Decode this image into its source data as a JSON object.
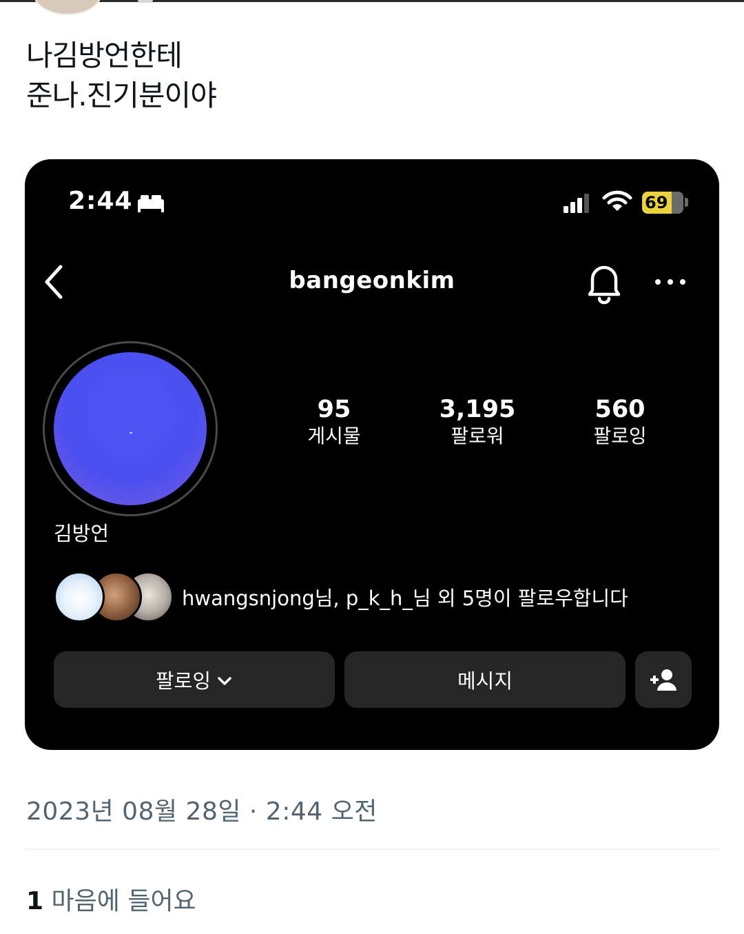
{
  "tweet": {
    "line1": "나김방언한테",
    "line2": "준나.진기분이야",
    "timestamp": "2023년 08월 28일 · 2:44 오전",
    "likes_count": "1",
    "likes_label": "마음에 들어요"
  },
  "phone": {
    "status": {
      "time": "2:44",
      "battery": "69",
      "battery_color": "#e9d23a",
      "icons": [
        "bed-icon",
        "signal-icon",
        "wifi-icon",
        "battery-icon"
      ]
    },
    "header": {
      "username": "bangeonkim",
      "icons": [
        "back-chevron-icon",
        "bell-icon",
        "more-icon"
      ]
    },
    "profile": {
      "display_name": "김방언",
      "stats": {
        "posts_value": "95",
        "posts_label": "게시물",
        "followers_value": "3,195",
        "followers_label": "팔로워",
        "following_value": "560",
        "following_label": "팔로잉"
      }
    },
    "mutual": {
      "text": "hwangsnjong님, p_k_h_님 외 5명이 팔로우합니다"
    },
    "buttons": {
      "following": "팔로잉",
      "message": "메시지",
      "add_user_icon": "add-user-icon"
    },
    "button_color": "#262626"
  }
}
